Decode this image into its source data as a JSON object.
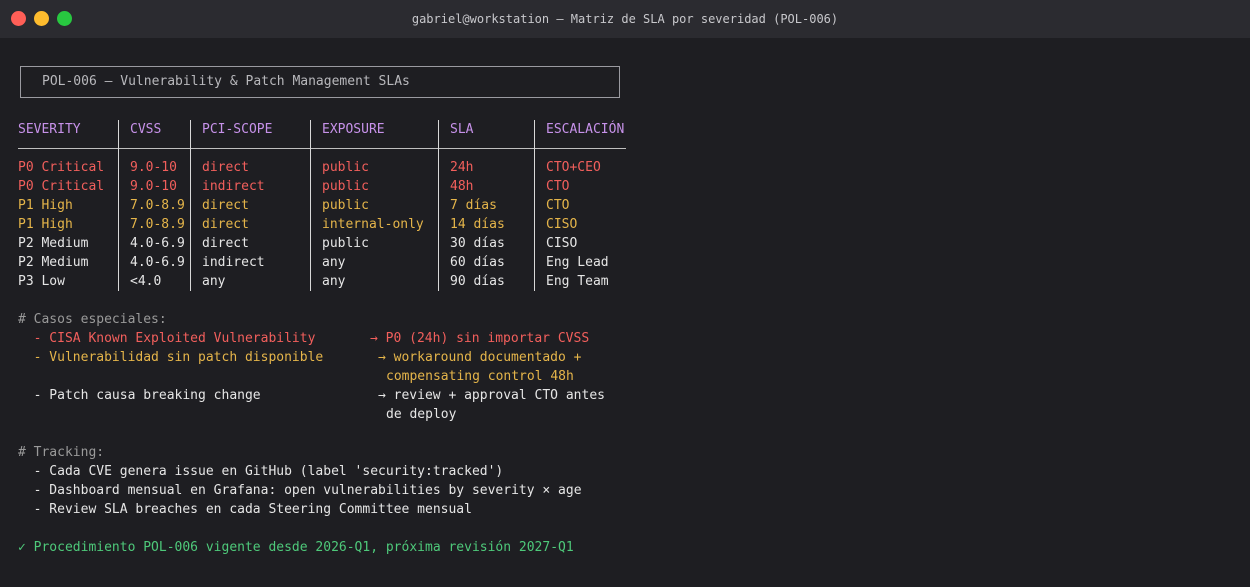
{
  "window": {
    "title": "gabriel@workstation — Matriz de SLA por severidad (POL-006)",
    "lights": [
      "#ff5f57",
      "#febc2e",
      "#28c840"
    ]
  },
  "banner": "POL-006 — Vulnerability & Patch Management SLAs",
  "table": {
    "headers": [
      "SEVERITY",
      "CVSS",
      "PCI-SCOPE",
      "EXPOSURE",
      "SLA",
      "ESCALACIÓN"
    ],
    "rows": [
      {
        "tone": "red",
        "cells": [
          "P0 Critical",
          "9.0-10",
          "direct",
          "public",
          "24h",
          "CTO+CEO"
        ]
      },
      {
        "tone": "red",
        "cells": [
          "P0 Critical",
          "9.0-10",
          "indirect",
          "public",
          "48h",
          "CTO"
        ]
      },
      {
        "tone": "amber",
        "cells": [
          "P1 High",
          "7.0-8.9",
          "direct",
          "public",
          "7 días",
          "CTO"
        ]
      },
      {
        "tone": "amber",
        "cells": [
          "P1 High",
          "7.0-8.9",
          "direct",
          "internal-only",
          "14 días",
          "CISO"
        ]
      },
      {
        "tone": "white",
        "cells": [
          "P2 Medium",
          "4.0-6.9",
          "direct",
          "public",
          "30 días",
          "CISO"
        ]
      },
      {
        "tone": "white",
        "cells": [
          "P2 Medium",
          "4.0-6.9",
          "indirect",
          "any",
          "60 días",
          "Eng Lead"
        ]
      },
      {
        "tone": "white",
        "cells": [
          "P3 Low",
          "<4.0",
          "any",
          "any",
          "90 días",
          "Eng Team"
        ]
      }
    ]
  },
  "special": {
    "heading": "# Casos especiales:",
    "items": [
      {
        "tone": "red",
        "left": "  - CISA Known Exploited Vulnerability",
        "right": "→ P0 (24h) sin importar CVSS",
        "cont": ""
      },
      {
        "tone": "amber",
        "left": "  - Vulnerabilidad sin patch disponible",
        "right": "→ workaround documentado +",
        "cont": "compensating control 48h"
      },
      {
        "tone": "white",
        "left": "  - Patch causa breaking change",
        "right": "→ review + approval CTO antes",
        "cont": "de deploy"
      }
    ]
  },
  "tracking": {
    "heading": "# Tracking:",
    "items": [
      "  - Cada CVE genera issue en GitHub (label 'security:tracked')",
      "  - Dashboard mensual en Grafana: open vulnerabilities by severity × age",
      "  - Review SLA breaches en cada Steering Committee mensual"
    ]
  },
  "footer": "✓ Procedimiento POL-006 vigente desde 2026-Q1, próxima revisión 2027-Q1"
}
